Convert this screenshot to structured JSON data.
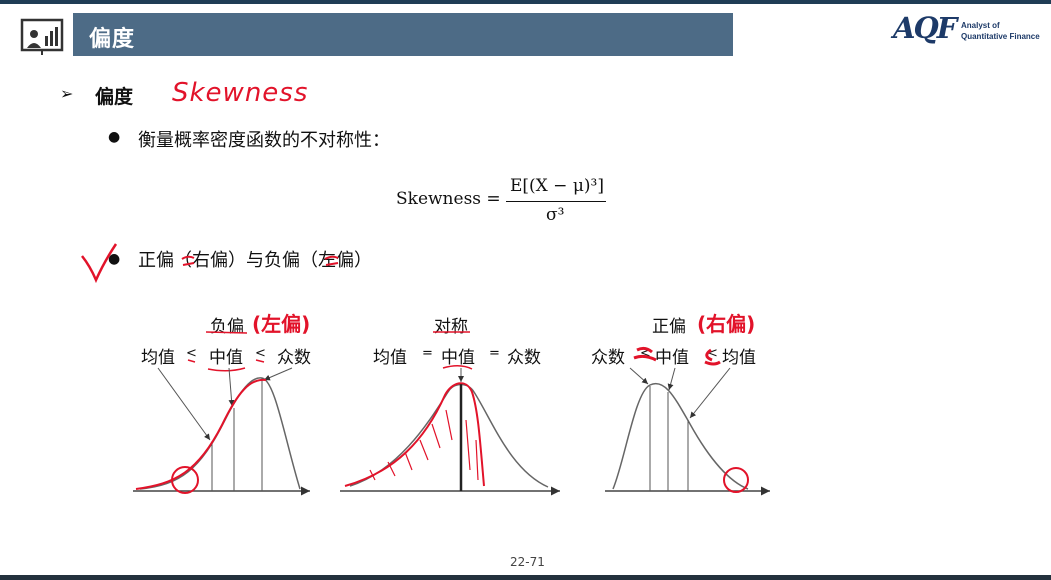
{
  "slide": {
    "title": "偏度",
    "logo_letters": "AQF",
    "logo_sub_line1": "Analyst of",
    "logo_sub_line2": "Quantitative Finance",
    "heading": "偏度",
    "handwritten_heading": "Skewness",
    "bullet1": "衡量概率密度函数的不对称性：",
    "formula": {
      "lhs": "Skewness =",
      "numerator": "E[(X − μ)³]",
      "denominator": "σ³"
    },
    "bullet2": "正偏（右偏）与负偏（左偏）",
    "page_number": "22-71"
  },
  "charts": [
    {
      "title": "负偏",
      "title_annotation": "(左偏)",
      "labels": [
        "均值",
        "<",
        "中值",
        "<",
        "众数"
      ]
    },
    {
      "title": "对称",
      "labels": [
        "均值",
        "=",
        "中值",
        "=",
        "众数"
      ]
    },
    {
      "title": "正偏",
      "title_annotation": "(右偏)",
      "labels": [
        "众数",
        "<",
        "中值",
        "<",
        "均值"
      ]
    }
  ],
  "colors": {
    "title_bar": "#4d6b86",
    "logo": "#1d3a68",
    "annotation_red": "#e2132a"
  }
}
